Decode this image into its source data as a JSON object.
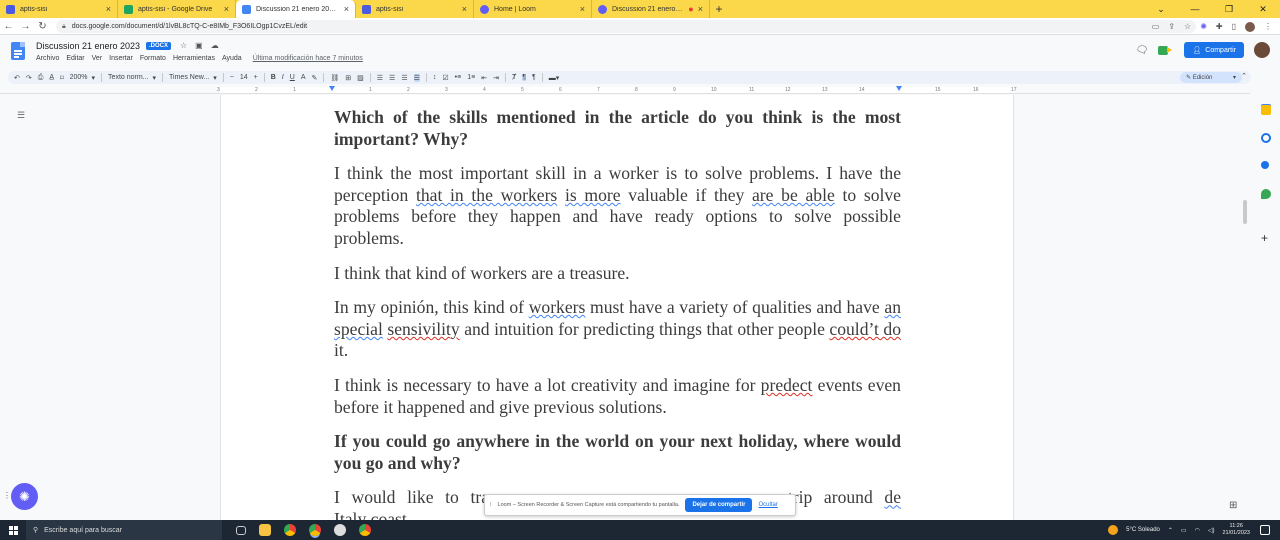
{
  "browser": {
    "tabs": [
      {
        "title": "aptis-sisi",
        "favicon_color": "#4b5ae0",
        "active": false
      },
      {
        "title": "aptis-sisi - Google Drive",
        "favicon_color": "#1fa463",
        "active": false
      },
      {
        "title": "Discussion 21 enero 2023.docx",
        "favicon_color": "#4285f4",
        "active": true
      },
      {
        "title": "aptis-sisi",
        "favicon_color": "#4b5ae0",
        "active": false
      },
      {
        "title": "Home | Loom",
        "favicon_color": "#625df5",
        "active": false
      },
      {
        "title": "Discussion 21 enero 2023.docx",
        "favicon_color": "#625df5",
        "active": false
      }
    ],
    "new_tab_symbol": "+",
    "url": "docs.google.com/document/d/1lvBL8cTQ-C-e8IMb_F3O6ILOgp1CvzEL/edit"
  },
  "docs": {
    "title": "Discussion  21 enero 2023",
    "badge": ".DOCX",
    "menu": [
      "Archivo",
      "Editar",
      "Ver",
      "Insertar",
      "Formato",
      "Herramientas",
      "Ayuda"
    ],
    "last_edit": "Última modificación hace 7 minutos",
    "share_label": "Compartir",
    "toolbar": {
      "zoom": "200%",
      "style": "Texto norm...",
      "font": "Times New...",
      "size": "14",
      "mode": "Edición"
    },
    "ruler_ticks": [
      "3",
      "2",
      "1",
      "1",
      "2",
      "3",
      "4",
      "5",
      "6",
      "7",
      "8",
      "9",
      "10",
      "11",
      "12",
      "13",
      "14",
      "15",
      "16",
      "17",
      "18"
    ]
  },
  "document": {
    "q1": "Which of the skills mentioned in the article do you think is the most important? Why?",
    "p1": {
      "a": "I think  the most important skill in a worker is to solve problems.  I have the perception ",
      "b": "that  in the workers",
      "c": " ",
      "d": "is more",
      "e": " valuable if they ",
      "f": "are  be  able",
      "g": " to solve problems before they happen and have ready options to solve possible problems."
    },
    "p2": "I think that kind of workers are a treasure.",
    "p3": {
      "a": "In my opinión, this kind of ",
      "b": "workers",
      "c": " must have a variety of qualities and have ",
      "d": "an  special",
      "e": " ",
      "f": "sensivility",
      "g": " and intuition for predicting things that other people ",
      "h": "could’t do",
      "i": " it."
    },
    "p4": {
      "a": "I think is necessary to have a lot creativity and imagine for ",
      "b": "predect",
      "c": " events even before it happened and give  previous solutions."
    },
    "q2": "If you could go anywhere in the world on your next holiday, where would you go and why?",
    "p5": {
      "a": "I would like to trav",
      "b": "trip around ",
      "c": "de",
      "d": "Italy coast."
    }
  },
  "loom_banner": {
    "message": "Loom – Screen Recorder & Screen Capture está compartiendo tu pantalla.",
    "stop_label": "Dejar de compartir",
    "hide_label": "Ocultar"
  },
  "taskbar": {
    "search_placeholder": "Escribe aquí para buscar",
    "weather": "5°C  Soleado",
    "time": "11:26",
    "date": "21/01/2023"
  }
}
